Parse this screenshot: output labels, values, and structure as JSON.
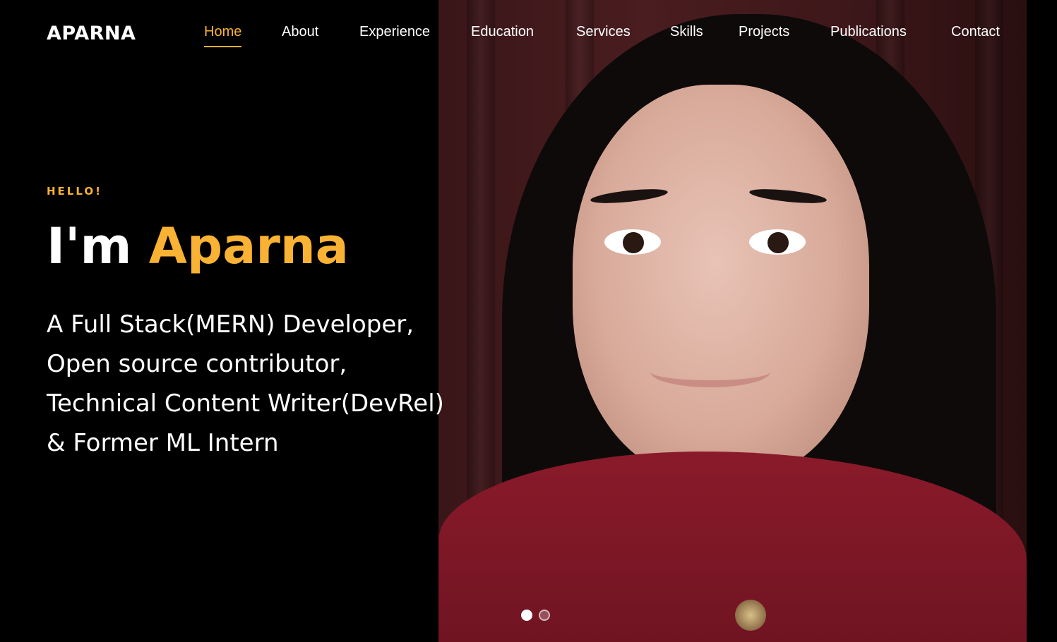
{
  "site": {
    "logo": "APARNA"
  },
  "nav": {
    "items": [
      {
        "label": "Home",
        "active": true
      },
      {
        "label": "About"
      },
      {
        "label": "Experience"
      },
      {
        "label": "Education"
      },
      {
        "label": "Services"
      },
      {
        "label": "Skills"
      },
      {
        "label": "Projects"
      },
      {
        "label": "Publications"
      },
      {
        "label": "Contact"
      }
    ]
  },
  "hero": {
    "greeting": "HELLO!",
    "prefix": "I'm",
    "name": "Aparna",
    "tagline": [
      "A Full Stack(MERN) Developer,",
      "Open source contributor,",
      "Technical Content Writer(DevRel)",
      "& Former ML Intern"
    ],
    "slides": {
      "total": 2,
      "current": 1
    }
  },
  "colors": {
    "accent": "#f9b233",
    "background": "#000000",
    "text": "#ffffff"
  }
}
